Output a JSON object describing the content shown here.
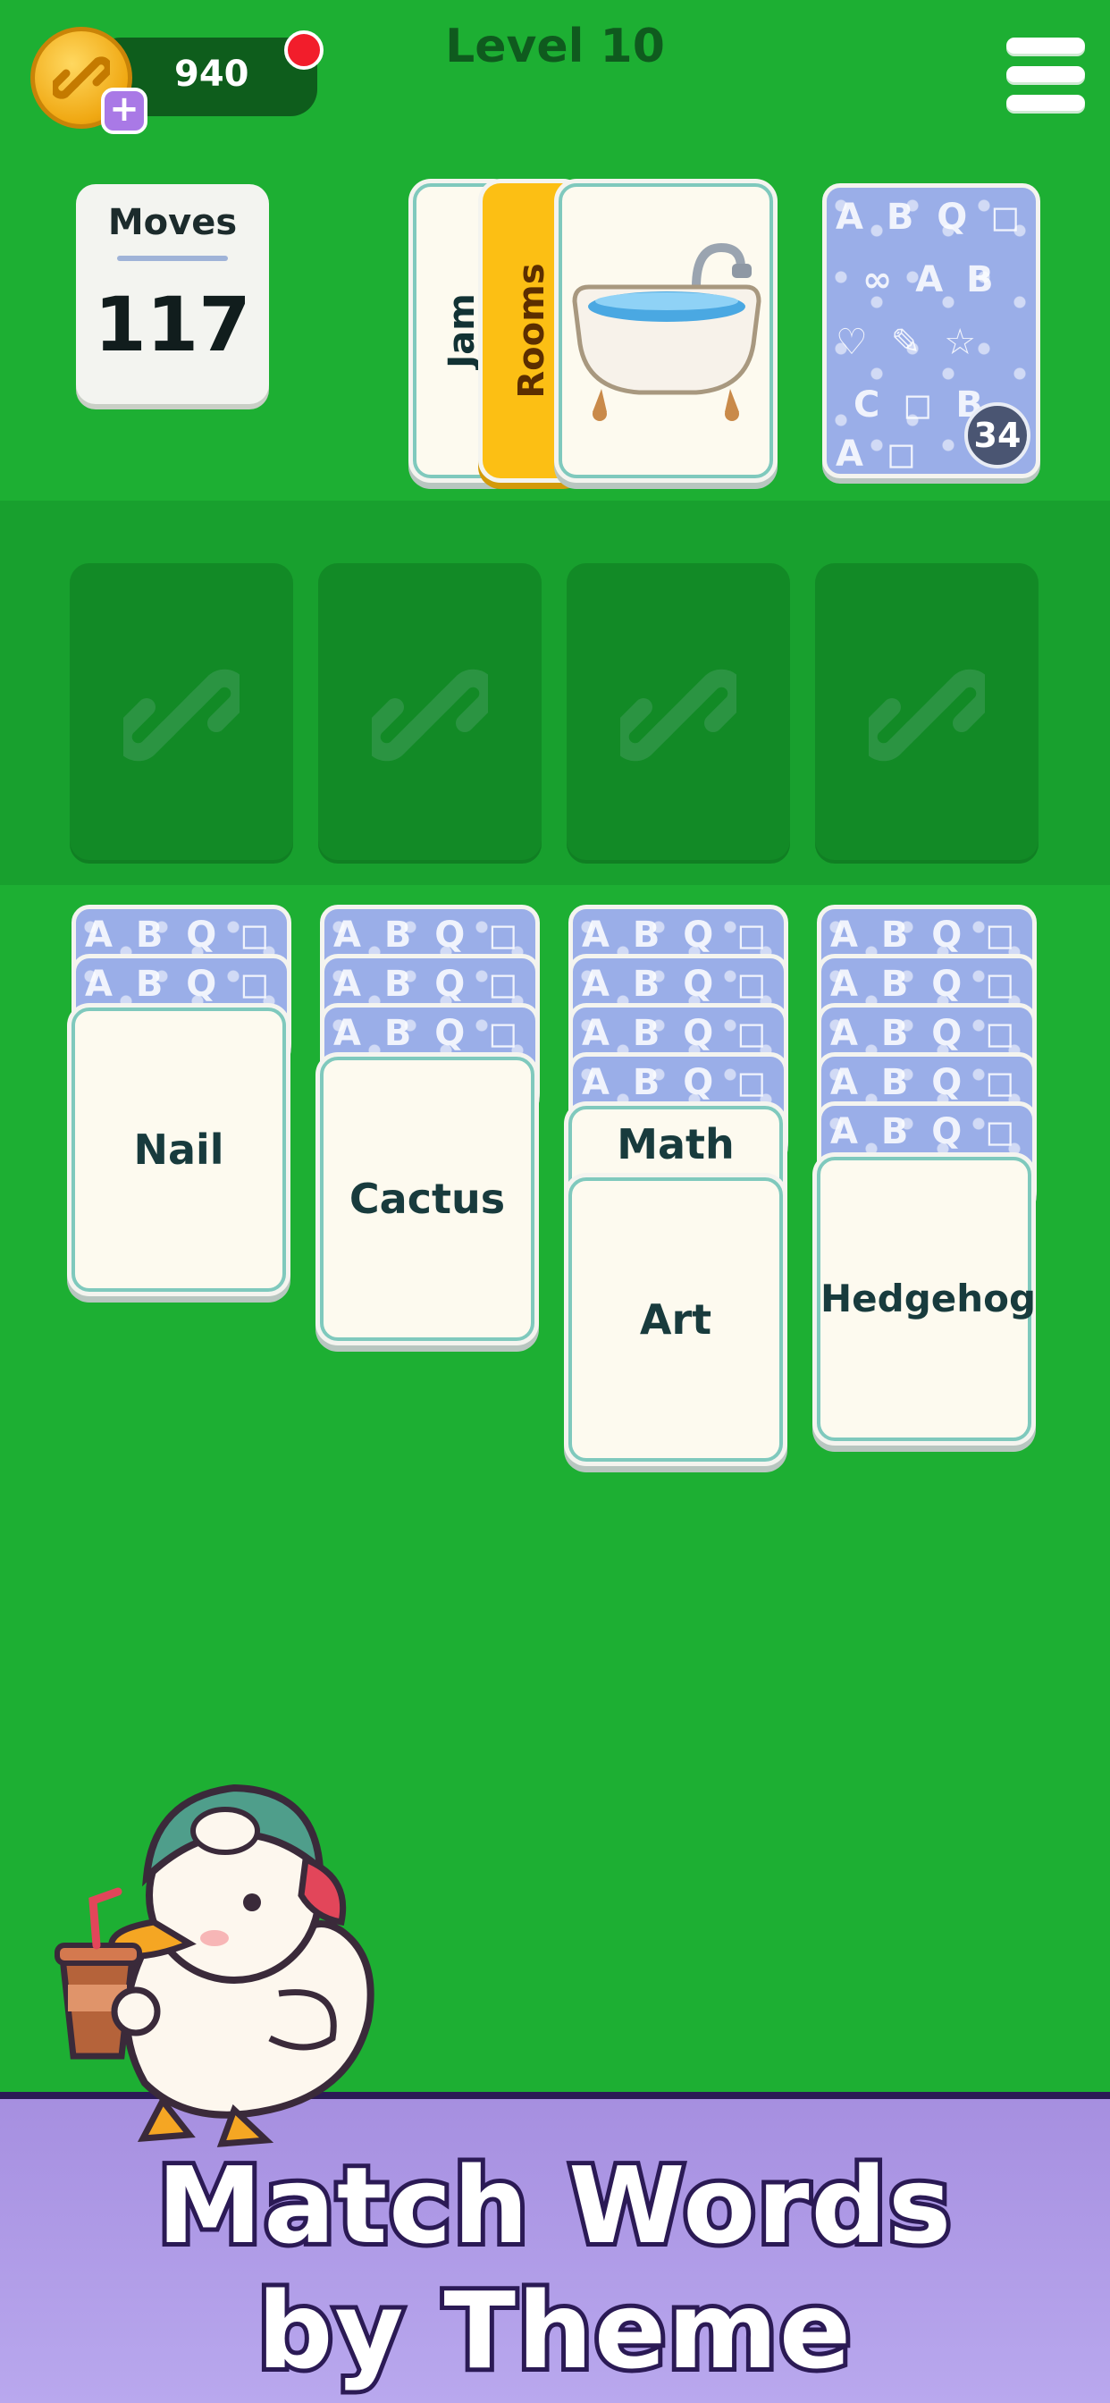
{
  "header": {
    "coins": "940",
    "level_title": "Level 10"
  },
  "moves": {
    "label": "Moves",
    "value": "117"
  },
  "waste": {
    "cards": [
      "Jam",
      "Rooms"
    ],
    "picture_card": "bathtub"
  },
  "stock": {
    "count": "34"
  },
  "foundation": {
    "slots": 4,
    "icon": "link-icon"
  },
  "tableau": [
    {
      "face_down": 2,
      "face_up": [
        "Nail"
      ]
    },
    {
      "face_down": 3,
      "face_up": [
        "Cactus"
      ]
    },
    {
      "face_down": 4,
      "face_up": [
        "Math",
        "Art"
      ]
    },
    {
      "face_down": 5,
      "face_up": [
        "Hedgehog"
      ]
    }
  ],
  "banner": {
    "line1": "Match Words",
    "line2": "by Theme"
  },
  "colors": {
    "background": "#1daf33",
    "card_border": "#7fc9bd",
    "card_back": "#9aaee8",
    "highlight_card": "#fcbf14",
    "banner": "#b9a8ee"
  }
}
